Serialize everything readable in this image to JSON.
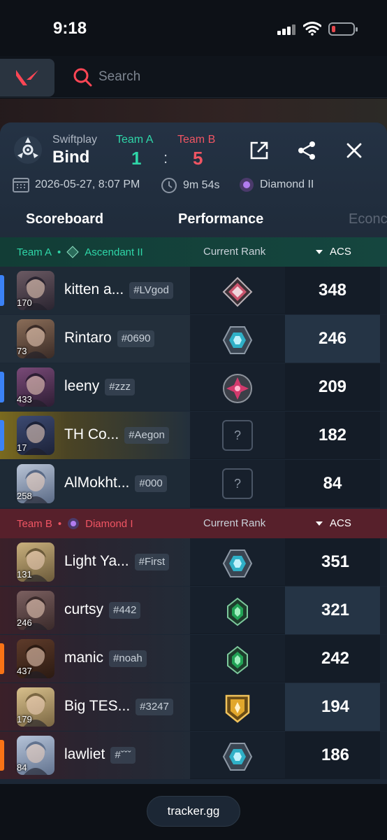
{
  "status_bar": {
    "time": "9:18"
  },
  "search": {
    "placeholder": "Search"
  },
  "match": {
    "mode": "Swiftplay",
    "map": "Bind",
    "team_a_label": "Team A",
    "team_b_label": "Team B",
    "score_a": "1",
    "score_sep": ":",
    "score_b": "5",
    "date": "2026-05-27, 8:07 PM",
    "duration": "9m 54s",
    "avg_rank": "Diamond II"
  },
  "tabs": [
    {
      "label": "Scoreboard",
      "active": true
    },
    {
      "label": "Performance",
      "active": false
    },
    {
      "label": "Econc",
      "active": false
    }
  ],
  "table": {
    "rank_header": "Current Rank",
    "acs_header": "ACS",
    "team_a": {
      "name": "Team A",
      "rank": "Ascendant II",
      "players": [
        {
          "name": "kitten a...",
          "tag": "#LVgod",
          "level": "170",
          "acs": "348",
          "rank_icon": "ascendant-icon",
          "accent": "#3b82f6"
        },
        {
          "name": "Rintaro",
          "tag": "#0690",
          "level": "73",
          "acs": "246",
          "rank_icon": "platinum-icon",
          "accent": ""
        },
        {
          "name": "leeny",
          "tag": "#zzz",
          "level": "433",
          "acs": "209",
          "rank_icon": "immortal-icon",
          "accent": "#3b82f6"
        },
        {
          "name": "TH Co...",
          "tag": "#Aegon",
          "level": "17",
          "acs": "182",
          "rank_icon": "unknown",
          "accent": "#3b82f6"
        },
        {
          "name": "AlMokht...",
          "tag": "#000",
          "level": "258",
          "acs": "84",
          "rank_icon": "unknown",
          "accent": ""
        }
      ]
    },
    "team_b": {
      "name": "Team B",
      "rank": "Diamond I",
      "players": [
        {
          "name": "Light Ya...",
          "tag": "#First",
          "level": "131",
          "acs": "351",
          "rank_icon": "platinum-icon",
          "accent": ""
        },
        {
          "name": "curtsy",
          "tag": "#442",
          "level": "246",
          "acs": "321",
          "rank_icon": "emerald-icon",
          "accent": ""
        },
        {
          "name": "manic",
          "tag": "#noah",
          "level": "437",
          "acs": "242",
          "rank_icon": "emerald-icon",
          "accent": "#f97316"
        },
        {
          "name": "Big TES...",
          "tag": "#3247",
          "level": "179",
          "acs": "194",
          "rank_icon": "gold-icon",
          "accent": ""
        },
        {
          "name": "lawliet",
          "tag": "#ˇˇˇ",
          "level": "84",
          "acs": "186",
          "rank_icon": "platinum-icon",
          "accent": "#f97316"
        }
      ]
    }
  },
  "footer": {
    "label": "tracker.gg"
  },
  "colors": {
    "team_a": "#2fd6a8",
    "team_b": "#f05563",
    "accent_red": "#e5484d"
  }
}
